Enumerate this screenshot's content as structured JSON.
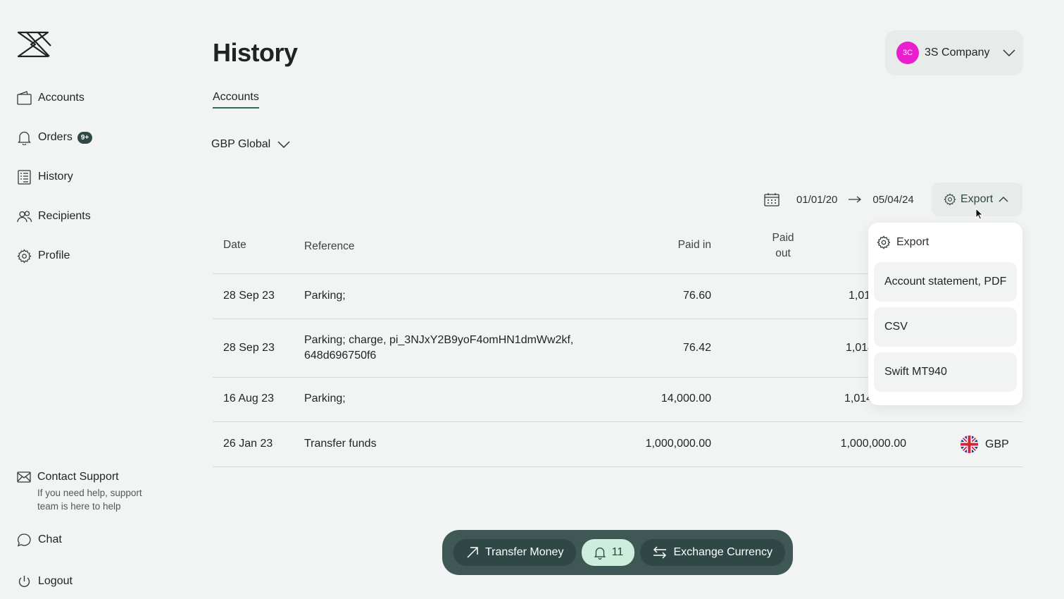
{
  "sidebar": {
    "items": [
      {
        "label": "Accounts",
        "icon": "wallet-icon"
      },
      {
        "label": "Orders",
        "icon": "bell-icon",
        "badge": "9+"
      },
      {
        "label": "History",
        "icon": "document-icon"
      },
      {
        "label": "Recipients",
        "icon": "users-icon"
      },
      {
        "label": "Profile",
        "icon": "gear-icon"
      }
    ],
    "support": {
      "title": "Contact Support",
      "text": "If you need help, support team is here to help"
    },
    "chat_label": "Chat",
    "logout_label": "Logout"
  },
  "header": {
    "title": "History",
    "company": {
      "initials": "3C",
      "name": "3S Company"
    }
  },
  "tabs": [
    {
      "label": "Accounts",
      "active": true
    }
  ],
  "account_select": {
    "value": "GBP Global"
  },
  "daterange": {
    "from": "01/01/20",
    "to": "05/04/24"
  },
  "export": {
    "label": "Export"
  },
  "table": {
    "columns": {
      "date": "Date",
      "reference": "Reference",
      "paid_in": "Paid in",
      "paid_out_line1": "Paid",
      "paid_out_line2": "out"
    },
    "rows": [
      {
        "date": "28 Sep 23",
        "reference": "Parking;",
        "paid_in": "76.60",
        "paid_out": "1,01",
        "currency": ""
      },
      {
        "date": "28 Sep 23",
        "reference": "Parking; charge, pi_3NJxY2B9yoF4omHN1dmWw2kf, 648d696750f6",
        "paid_in": "76.42",
        "paid_out": "1,014",
        "currency": ""
      },
      {
        "date": "16 Aug 23",
        "reference": "Parking;",
        "paid_in": "14,000.00",
        "paid_out": "1,014,",
        "currency": ""
      },
      {
        "date": "26 Jan 23",
        "reference": "Transfer funds",
        "paid_in": "1,000,000.00",
        "paid_out": "1,000,000.00",
        "currency": "GBP"
      }
    ]
  },
  "export_menu": {
    "header": "Export",
    "items": [
      "Account statement, PDF",
      "CSV",
      "Swift MT940"
    ]
  },
  "actionbar": {
    "transfer_label": "Transfer Money",
    "notif_count": "11",
    "exchange_label": "Exchange Currency"
  },
  "colors": {
    "accent": "#2f4a46",
    "avatar": "#e81ecf",
    "notif": "#cdeedd"
  }
}
